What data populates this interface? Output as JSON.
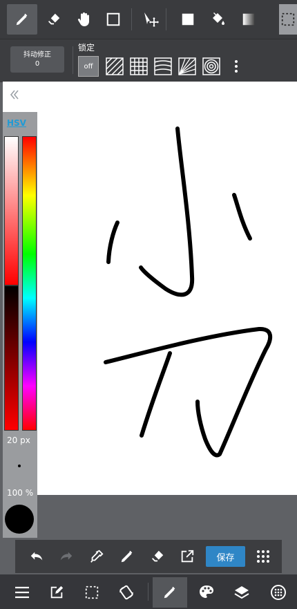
{
  "stabilizer": {
    "label": "抖动修正",
    "value": "0"
  },
  "lock": {
    "label": "锁定",
    "off_label": "off"
  },
  "color_panel": {
    "mode": "HSV",
    "brush_size": "20 px",
    "opacity": "100 %",
    "current_color": "#000000"
  },
  "actions": {
    "save_label": "保存"
  },
  "colors": {
    "accent": "#2f86c6",
    "toolbar": "#3a3b3e",
    "canvas": "#ffffff"
  },
  "toolbar": {
    "icons": [
      "pen-icon",
      "eraser-icon",
      "hand-icon",
      "rectangle-icon",
      "move-icon",
      "fill-rect-icon",
      "bucket-icon",
      "gradient-icon",
      "selection-icon"
    ]
  },
  "bottom": {
    "icons": [
      "menu-icon",
      "edit-icon",
      "select-icon",
      "rotate-icon",
      "brush-icon",
      "palette-icon",
      "layers-icon",
      "grid-circle-icon"
    ]
  }
}
